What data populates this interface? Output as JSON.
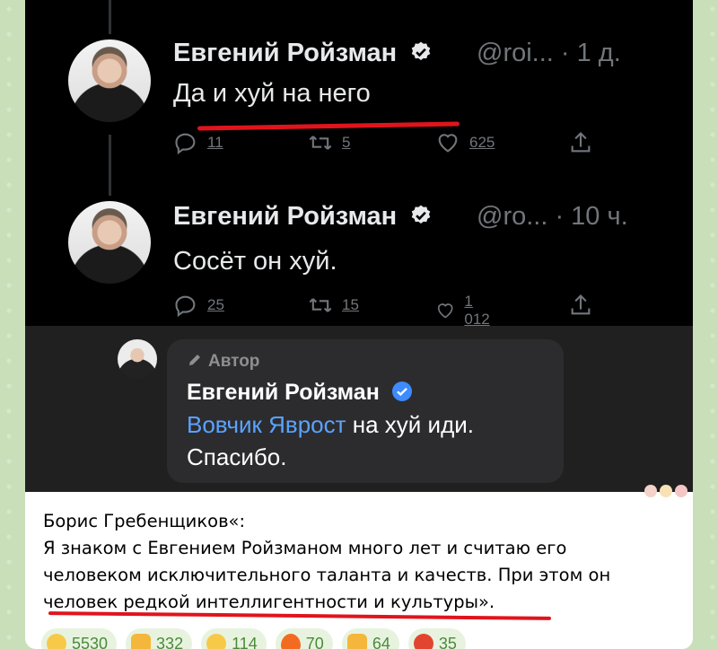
{
  "tweets": [
    {
      "name": "Евгений Ройзман",
      "handle": "@roi... · 1 д.",
      "text": "Да и хуй на него",
      "replies": "11",
      "retweets": "5",
      "likes": "625"
    },
    {
      "name": "Евгений Ройзман",
      "handle": "@ro... · 10 ч.",
      "text": "Сосёт он хуй.",
      "replies": "25",
      "retweets": "15",
      "likes": "1 012"
    }
  ],
  "bubble": {
    "author_label": "Автор",
    "name": "Евгений Ройзман",
    "mention": "Вовчик Яврост",
    "line1_rest": " на хуй иди.",
    "line2": "Спасибо."
  },
  "caption": {
    "lines": [
      "Борис Гребенщиков«:",
      "Я знаком с Евгением Ройзманом много лет и считаю его",
      "человеком исключительного таланта и качеств. При этом он",
      "человек редкой интеллигентности и культуры»."
    ]
  },
  "reactions": [
    {
      "icon": "grinning-face-icon",
      "count": "5530",
      "color": "#f7c948"
    },
    {
      "icon": "thumbs-down-icon",
      "count": "332",
      "color": "#f5b73b"
    },
    {
      "icon": "screaming-face-icon",
      "count": "114",
      "color": "#f7c948"
    },
    {
      "icon": "fire-icon",
      "count": "70",
      "color": "#f26b21"
    },
    {
      "icon": "thumbs-up-icon",
      "count": "64",
      "color": "#f5b73b"
    },
    {
      "icon": "angry-face-icon",
      "count": "35",
      "color": "#e2452f"
    }
  ],
  "colors": {
    "underline": "#e0141c",
    "mention": "#5aa3ff",
    "verified": "#e7e9ea"
  }
}
